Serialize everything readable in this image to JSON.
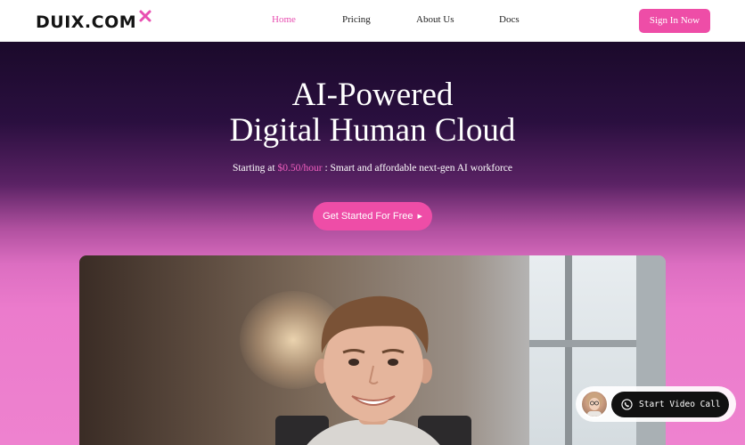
{
  "brand": {
    "name": "DUIX.COM",
    "accent": "#ee4da7"
  },
  "nav": {
    "items": [
      {
        "label": "Home",
        "active": true
      },
      {
        "label": "Pricing",
        "active": false
      },
      {
        "label": "About Us",
        "active": false
      },
      {
        "label": "Docs",
        "active": false
      }
    ],
    "signin_label": "Sign In Now"
  },
  "hero": {
    "title_line1": "AI-Powered",
    "title_line2": "Digital Human Cloud",
    "subtitle_prefix": "Starting at ",
    "subtitle_price": "$0.50/hour",
    "subtitle_suffix": " : Smart and affordable next-gen AI workforce",
    "cta_label": "Get Started For Free"
  },
  "video_call": {
    "button_label": "Start Video Call"
  },
  "icons": {
    "logo_mark": "x-mark-icon",
    "cta_arrow": "play-arrow-icon",
    "call": "phone-icon"
  }
}
